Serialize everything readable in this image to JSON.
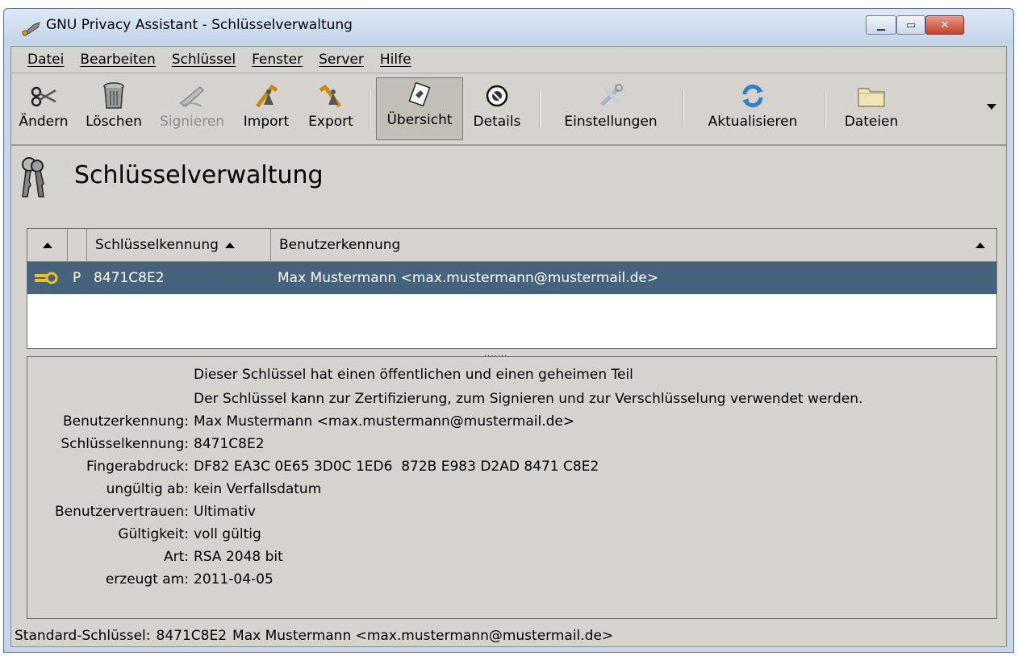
{
  "window": {
    "title": "GNU Privacy Assistant - Schlüsselverwaltung",
    "minimize_label": "▁",
    "maximize_label": "▭",
    "close_label": "✕"
  },
  "menu": [
    "Datei",
    "Bearbeiten",
    "Schlüssel",
    "Fenster",
    "Server",
    "Hilfe"
  ],
  "toolbar": {
    "change": "Ändern",
    "delete": "Löschen",
    "sign": "Signieren",
    "import": "Import",
    "export": "Export",
    "overview": "Übersicht",
    "details": "Details",
    "settings": "Einstellungen",
    "refresh": "Aktualisieren",
    "files": "Dateien"
  },
  "heading": "Schlüsselverwaltung",
  "table": {
    "columns": [
      "Schlüsselkennung",
      "Benutzerkennung"
    ],
    "rows": [
      {
        "type": "P",
        "key_id": "8471C8E2",
        "user_id": "Max Mustermann <max.mustermann@mustermail.de>",
        "selected": true
      }
    ]
  },
  "splitter": ".......",
  "details": {
    "line1": "Dieser Schlüssel hat einen öffentlichen und einen geheimen Teil",
    "line2": "Der Schlüssel kann zur Zertifizierung, zum Signieren und zur Verschlüsselung verwendet werden.",
    "fields": [
      {
        "label": "Benutzerkennung:",
        "value": "Max Mustermann <max.mustermann@mustermail.de>"
      },
      {
        "label": "Schlüsselkennung:",
        "value": "8471C8E2"
      },
      {
        "label": "Fingerabdruck:",
        "value": "DF82 EA3C 0E65 3D0C 1ED6  872B E983 D2AD 8471 C8E2"
      },
      {
        "label": "ungültig ab:",
        "value": "kein Verfallsdatum"
      },
      {
        "label": "Benutzervertrauen:",
        "value": "Ultimativ"
      },
      {
        "label": "Gültigkeit:",
        "value": "voll gültig"
      },
      {
        "label": "Art:",
        "value": "RSA 2048 bit"
      },
      {
        "label": "erzeugt am:",
        "value": "2011-04-05"
      }
    ]
  },
  "status": {
    "label": "Standard-Schlüssel:",
    "key_id": "8471C8E2",
    "user": "Max Mustermann <max.mustermann@mustermail.de>"
  },
  "colors": {
    "selection": "#46637d",
    "panel": "#d6d3ce"
  }
}
